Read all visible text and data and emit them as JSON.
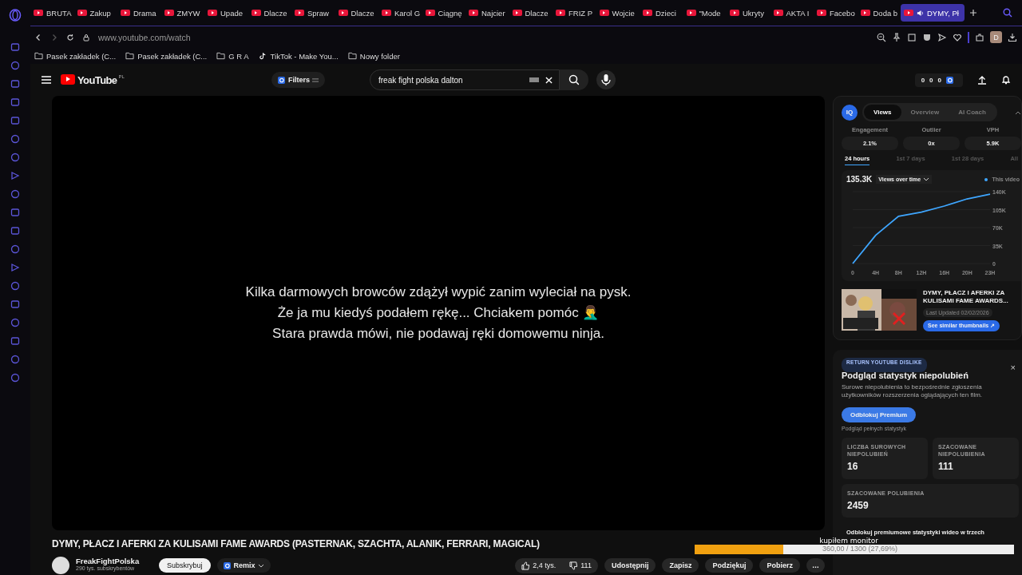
{
  "tabs": [
    {
      "label": "BRUTA",
      "selected": false
    },
    {
      "label": "Zakup",
      "selected": false
    },
    {
      "label": "Drama",
      "selected": false
    },
    {
      "label": "ZMYW",
      "selected": false
    },
    {
      "label": "Upade",
      "selected": false
    },
    {
      "label": "Dlacze",
      "selected": false
    },
    {
      "label": "Spraw",
      "selected": false
    },
    {
      "label": "Dlacze",
      "selected": false
    },
    {
      "label": "Karol G",
      "selected": false
    },
    {
      "label": "Ciągnę",
      "selected": false
    },
    {
      "label": "Najcier",
      "selected": false
    },
    {
      "label": "Dlacze",
      "selected": false
    },
    {
      "label": "FRIZ P",
      "selected": false
    },
    {
      "label": "Wojcie",
      "selected": false
    },
    {
      "label": "Dzieci",
      "selected": false
    },
    {
      "label": "\"Mode",
      "selected": false
    },
    {
      "label": "Ukryty",
      "selected": false
    },
    {
      "label": "AKTA I",
      "selected": false
    },
    {
      "label": "Facebo",
      "selected": false
    },
    {
      "label": "Doda b",
      "selected": false
    },
    {
      "label": "DYMY, Pł",
      "selected": true
    }
  ],
  "address": "www.youtube.com/watch",
  "avatar": "D",
  "bookmarks": [
    {
      "label": "Pasek zakładek (C...",
      "kind": "folder"
    },
    {
      "label": "Pasek zakładek (C...",
      "kind": "folder"
    },
    {
      "label": "G R A",
      "kind": "folder"
    },
    {
      "label": "TikTok - Make You...",
      "kind": "tiktok"
    },
    {
      "label": "Nowy folder",
      "kind": "folder"
    }
  ],
  "header": {
    "logo": "YouTube",
    "region": "PL",
    "filters": "Filters",
    "search": "freak fight polska dalton",
    "counters": [
      "0",
      "0",
      "0"
    ]
  },
  "video": {
    "captions": [
      "Kilka darmowych browców zdążył wypić zanim wyleciał na pysk.",
      "Że ja mu kiedyś podałem rękę... Chciakem pomóc 🤦‍♂️",
      "Stara prawda mówi, nie podawaj ręki domowemu ninja."
    ]
  },
  "title": "DYMY, PŁACZ I AFERKI ZA KULISAMI FAME AWARDS (PASTERNAK, SZACHTA, ALANIK, FERRARI, MAGICAL)",
  "channel": {
    "name": "FreakFightPolska",
    "subscribers": "290 tys. subskrybentów",
    "subscribe": "Subskrybuj",
    "remix": "Remix"
  },
  "actions": {
    "likes": "2,4 tys.",
    "dislikes": "111",
    "buttons": [
      "Udostępnij",
      "Zapisz",
      "Podziękuj",
      "Pobierz"
    ],
    "more": "…"
  },
  "panel": {
    "logo": "IQ",
    "tabs": [
      {
        "label": "Views",
        "selected": true
      },
      {
        "label": "Overview",
        "selected": false
      },
      {
        "label": "AI Coach",
        "selected": false
      }
    ],
    "metrics": [
      {
        "label": "Engagement",
        "value": "2.1%"
      },
      {
        "label": "Outlier",
        "value": "0x"
      },
      {
        "label": "VPH",
        "value": "5.9K"
      }
    ],
    "ranges": [
      {
        "label": "24 hours",
        "selected": true
      },
      {
        "label": "1st 7 days",
        "selected": false
      },
      {
        "label": "1st 28 days",
        "selected": false
      },
      {
        "label": "All",
        "selected": false
      }
    ],
    "total": "135.3K",
    "metric_select": "Views over time",
    "chart_data": {
      "type": "line",
      "categories": [
        "0",
        "4H",
        "8H",
        "12H",
        "16H",
        "20H",
        "23H"
      ],
      "series": [
        {
          "name": "This video",
          "color": "#3ea6ff",
          "values": [
            0,
            55000,
            92000,
            100000,
            112000,
            126000,
            135000
          ]
        }
      ],
      "ylim": [
        0,
        140000
      ],
      "yticks": [
        {
          "value": 0,
          "label": "0"
        },
        {
          "value": 35000,
          "label": "35K"
        },
        {
          "value": 70000,
          "label": "70K"
        },
        {
          "value": 105000,
          "label": "105K"
        },
        {
          "value": 140000,
          "label": "140K"
        }
      ]
    },
    "thumb_title": "DYMY, PŁACZ I AFERKI ZA KULISAMI FAME AWARDS...",
    "updated": "Last Updated 02/02/2026",
    "similar": "See similar thumbnails ↗"
  },
  "dislike": {
    "badge": "RETURN YOUTUBE DISLIKE",
    "close": "×",
    "title": "Podgląd statystyk niepolubień",
    "text": "Surowe niepolubienia to bezpośrednie zgłoszenia użytkowników rozszerzenia oglądających ten film.",
    "button": "Odblokuj Premium",
    "note": "Podgląd pełnych statystyk",
    "stats": [
      {
        "label": "LICZBA SUROWYCH NIEPOLUBIEŃ",
        "value": "16"
      },
      {
        "label": "SZACOWANE NIEPOLUBIENIA",
        "value": "111"
      },
      {
        "label": "SZACOWANE POLUBIENIA",
        "value": "2459"
      }
    ],
    "promo": "Odblokuj premiumowe statystyki wideo w trzech"
  },
  "goal": {
    "title": "kupiłem monitor",
    "reading": "360,00 / 1300 (27,69%)",
    "level": 0.2769
  }
}
